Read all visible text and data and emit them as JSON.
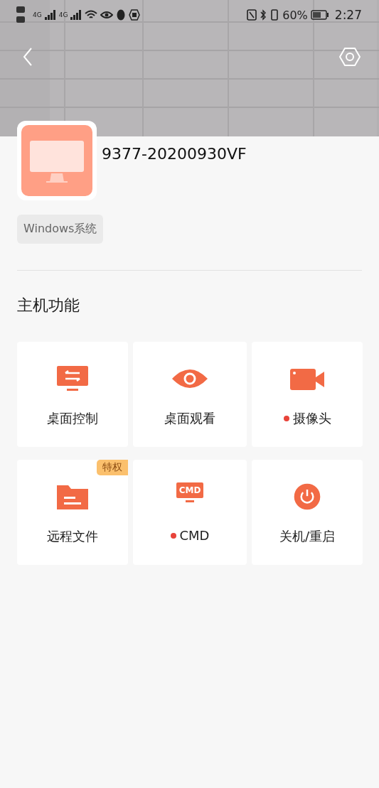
{
  "status_bar": {
    "network_left": "4G",
    "network_right": "4G",
    "battery": "60%",
    "time": "2:27"
  },
  "device": {
    "name": "9377-20200930VF",
    "os_tag": "Windows系统"
  },
  "section_title": "主机功能",
  "functions": [
    {
      "kind": "desktop-control",
      "label": "桌面控制",
      "dot": false
    },
    {
      "kind": "desktop-view",
      "label": "桌面观看",
      "dot": false
    },
    {
      "kind": "camera",
      "label": "摄像头",
      "dot": true
    },
    {
      "kind": "files",
      "label": "远程文件",
      "dot": false,
      "badge": "特权"
    },
    {
      "kind": "cmd",
      "label": "CMD",
      "dot": true,
      "icon_text": "CMD"
    },
    {
      "kind": "power",
      "label": "关机/重启",
      "dot": false
    }
  ]
}
